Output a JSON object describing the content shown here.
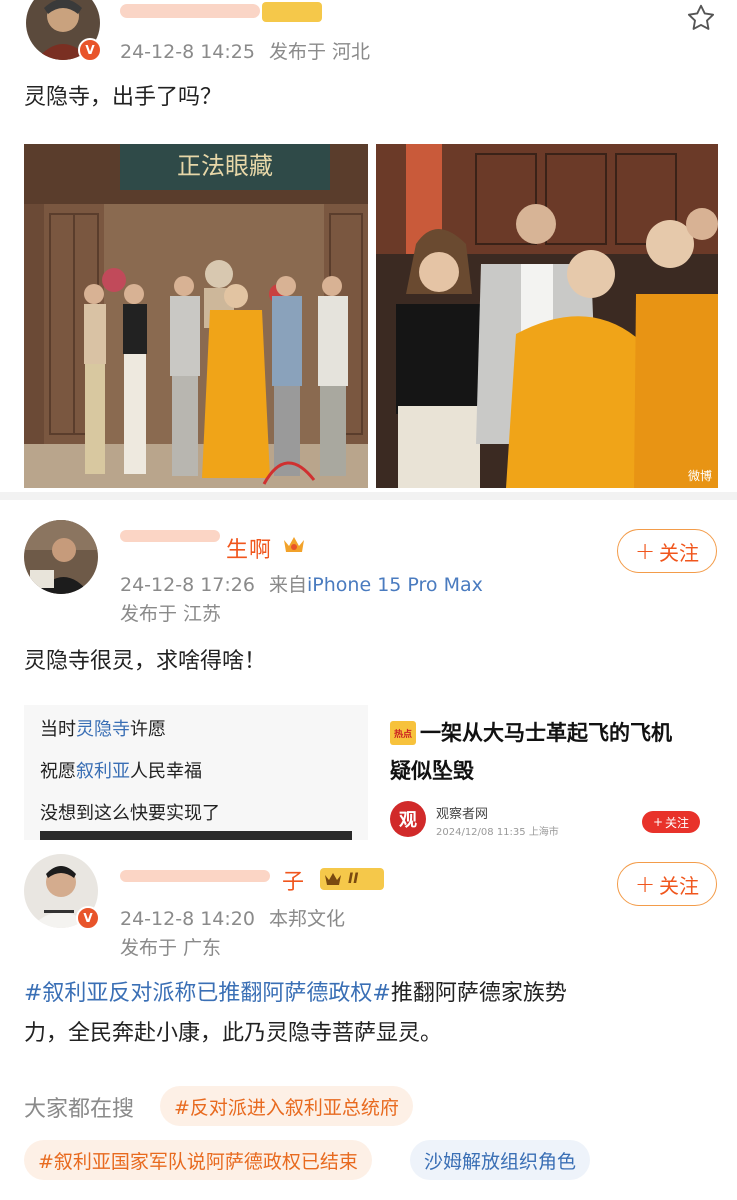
{
  "post1": {
    "meta_time": "24-12-8 14:25",
    "meta_location": "发布于 河北",
    "text": "灵隐寺，出手了吗？",
    "photo_left_sign": "正法眼藏",
    "photo_right_watermark": "微博"
  },
  "post2": {
    "username": "生啊",
    "meta_time": "24-12-8 17:26",
    "meta_from": "来自",
    "meta_device": "iPhone 15 Pro Max",
    "meta_location": "发布于 江苏",
    "follow_label": "关注",
    "text": "灵隐寺很灵，求啥得啥！",
    "thumb_left": {
      "line1_pre": "当时",
      "line1_hl": "灵隐寺",
      "line1_post": "许愿",
      "line2_pre": "祝愿",
      "line2_hl": "叙利亚",
      "line2_post": "人民幸福",
      "line3": "没想到这么快要实现了"
    },
    "thumb_right": {
      "badge": "热点",
      "headline_line1": "一架从大马士革起飞的飞机",
      "headline_line2": "疑似坠毁",
      "source_name": "观察者网",
      "source_meta": "2024/12/08 11:35 上海市",
      "follow_label": "关注"
    }
  },
  "post3": {
    "username": "子",
    "level_badge": "II",
    "meta_time": "24-12-8 14:20",
    "meta_source": "本邦文化",
    "meta_location": "发布于 广东",
    "follow_label": "关注",
    "text_tag": "#叙利亚反对派称已推翻阿萨德政权#",
    "text_line1_rest": "推翻阿萨德家族势",
    "text_line2": "力，全民奔赴小康，此乃灵隐寺菩萨显灵。",
    "search_label": "大家都在搜",
    "chips": [
      "#反对派进入叙利亚总统府",
      "#叙利亚国家军队说阿萨德政权已结束",
      "沙姆解放组织角色"
    ]
  },
  "colors": {
    "accent_orange": "#f0561d",
    "link_blue": "#3a6fb5",
    "meta_gray": "#8a8a8a"
  }
}
